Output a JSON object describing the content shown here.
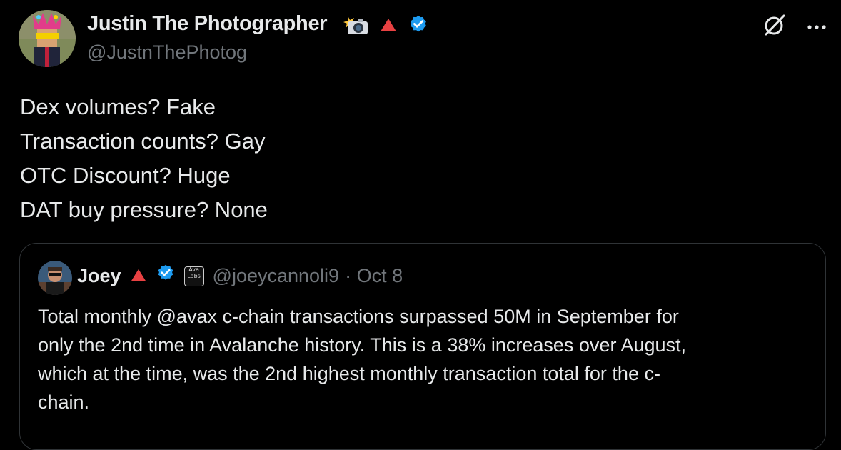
{
  "post": {
    "author_name": "Justin The Photographer",
    "author_handle": "@JustnThePhotog",
    "lines": [
      "Dex volumes? Fake",
      "Transaction counts? Gay",
      "OTC Discount? Huge",
      "DAT buy pressure? None"
    ]
  },
  "quoted": {
    "author_name": "Joey",
    "org_badge_text": "Ava Labs.",
    "author_handle": "@joeycannoli9",
    "date": "· Oct 8",
    "lines": [
      "Total monthly @avax c-chain transactions surpassed 50M in September for",
      "only the 2nd time in Avalanche history. This is a 38% increases over August,",
      "which at the time, was the 2nd highest monthly transaction total for the c-",
      "chain."
    ]
  },
  "colors": {
    "background": "#000000",
    "text": "#e7e9ea",
    "secondary_text": "#71767b",
    "verified_blue": "#1d9bf0",
    "triangle_red": "#e84142"
  },
  "icons": [
    "camera-flash-icon",
    "red-triangle-icon",
    "verified-badge-icon",
    "grok-icon",
    "more-icon"
  ]
}
